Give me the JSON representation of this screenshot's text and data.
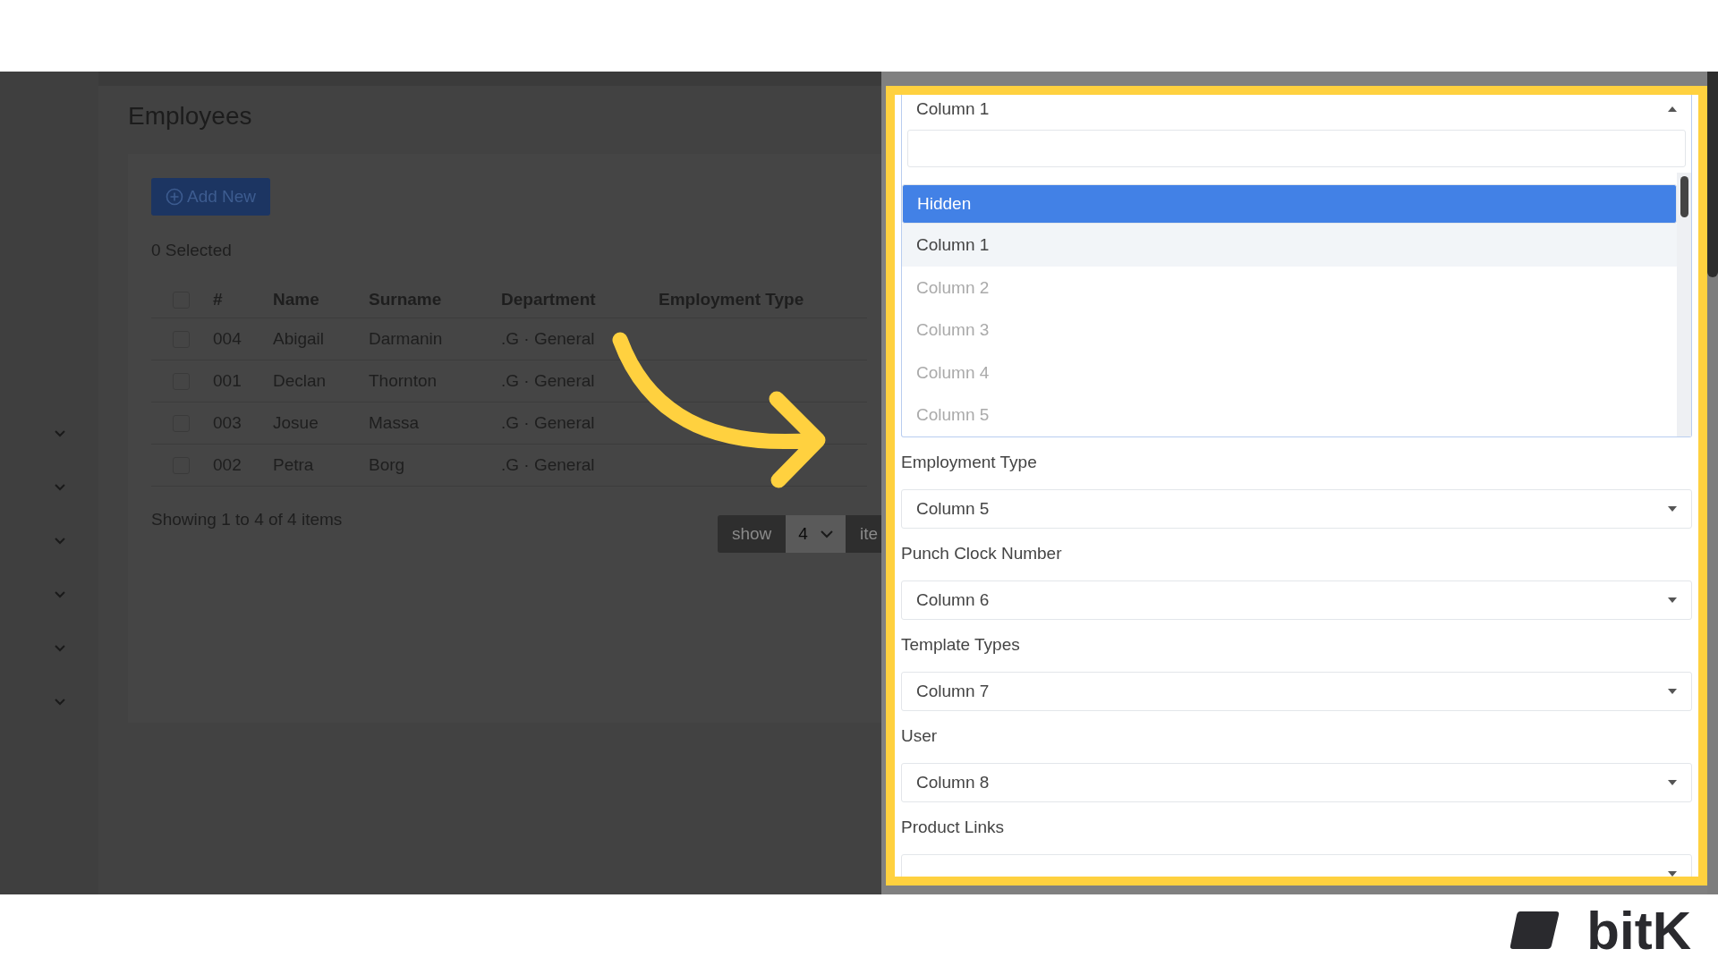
{
  "sidebar": {
    "items": [
      {
        "expanded": false
      },
      {
        "expanded": false
      },
      {
        "expanded": false
      },
      {
        "expanded": false
      },
      {
        "expanded": false
      },
      {
        "expanded": false
      }
    ]
  },
  "page": {
    "title": "Employees",
    "add_button": "Add New",
    "selected_count": "0 Selected",
    "table": {
      "all_checked": false,
      "columns": [
        "#",
        "Name",
        "Surname",
        "Department",
        "Employment Type"
      ],
      "rows": [
        {
          "checked": false,
          "cells": [
            "004",
            "Abigail",
            "Darmanin",
            ".G · General"
          ]
        },
        {
          "checked": false,
          "cells": [
            "001",
            "Declan",
            "Thornton",
            ".G · General"
          ]
        },
        {
          "checked": false,
          "cells": [
            "003",
            "Josue",
            "Massa",
            ".G · General"
          ]
        },
        {
          "checked": false,
          "cells": [
            "002",
            "Petra",
            "Borg",
            ".G · General"
          ]
        }
      ]
    },
    "summary": "Showing 1 to 4 of 4 items",
    "page_size": {
      "label": "show",
      "value": "4",
      "suffix": "ite"
    }
  },
  "mapping_panel": {
    "open_select": {
      "value": "Column 1",
      "expanded": true,
      "options": [
        {
          "label": "Hidden",
          "highlighted": true,
          "selected": false,
          "disabled": false
        },
        {
          "label": "Column 1",
          "highlighted": false,
          "selected": true,
          "disabled": false
        },
        {
          "label": "Column 2",
          "highlighted": false,
          "selected": false,
          "disabled": true
        },
        {
          "label": "Column 3",
          "highlighted": false,
          "selected": false,
          "disabled": true
        },
        {
          "label": "Column 4",
          "highlighted": false,
          "selected": false,
          "disabled": true
        },
        {
          "label": "Column 5",
          "highlighted": false,
          "selected": false,
          "disabled": true
        }
      ]
    },
    "fields": [
      {
        "label": "Employment Type",
        "value": "Column 5"
      },
      {
        "label": "Punch Clock Number",
        "value": "Column 6"
      },
      {
        "label": "Template Types",
        "value": "Column 7"
      },
      {
        "label": "User",
        "value": "Column 8"
      },
      {
        "label": "Product Links"
      }
    ]
  },
  "logo": {
    "text": "bitK"
  }
}
